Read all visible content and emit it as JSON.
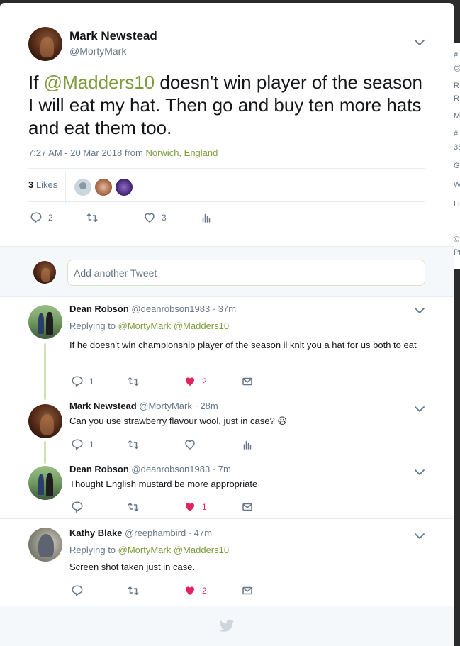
{
  "side": {
    "letters": [
      "#",
      "@",
      "R",
      "R",
      "M",
      "#",
      "35",
      "G",
      "W",
      "Li",
      "©",
      "Pr"
    ]
  },
  "tweet": {
    "author_name": "Mark Newstead",
    "author_handle": "@MortyMark",
    "text_before": "If ",
    "mention": "@Madders10",
    "text_after": " doesn't win player of the season I will eat my hat. Then go and buy ten more hats and eat them too.",
    "time": "7:27 AM - 20 Mar 2018 from ",
    "location": "Norwich, England",
    "likes_num": "3",
    "likes_label": " Likes",
    "replies": "2",
    "hearts": "3"
  },
  "compose": {
    "placeholder": "Add another Tweet"
  },
  "replies": [
    {
      "name": "Dean Robson",
      "handle": "@deanrobson1983 · 37m",
      "replying_prefix": "Replying to ",
      "replying_to": "@MortyMark @Madders10",
      "text": "If he doesn't win championship player of the season il knit you a hat for us both to eat",
      "replies": "1",
      "likes": "2"
    },
    {
      "name": "Mark Newstead",
      "handle": "@MortyMark · 28m",
      "text": "Can you use strawberry flavour wool, just in case? 😃",
      "replies": "1"
    },
    {
      "name": "Dean Robson",
      "handle": "@deanrobson1983 · 7m",
      "text": "Thought English mustard be more appropriate",
      "likes": "1"
    },
    {
      "name": "Kathy Blake",
      "handle": "@reephambird · 47m",
      "replying_prefix": "Replying to ",
      "replying_to": "@MortyMark @Madders10",
      "text": "Screen shot taken just in case.",
      "likes": "2"
    }
  ],
  "colors": {
    "accent": "#7d9b3b",
    "like": "#e0245e",
    "muted": "#657786"
  }
}
